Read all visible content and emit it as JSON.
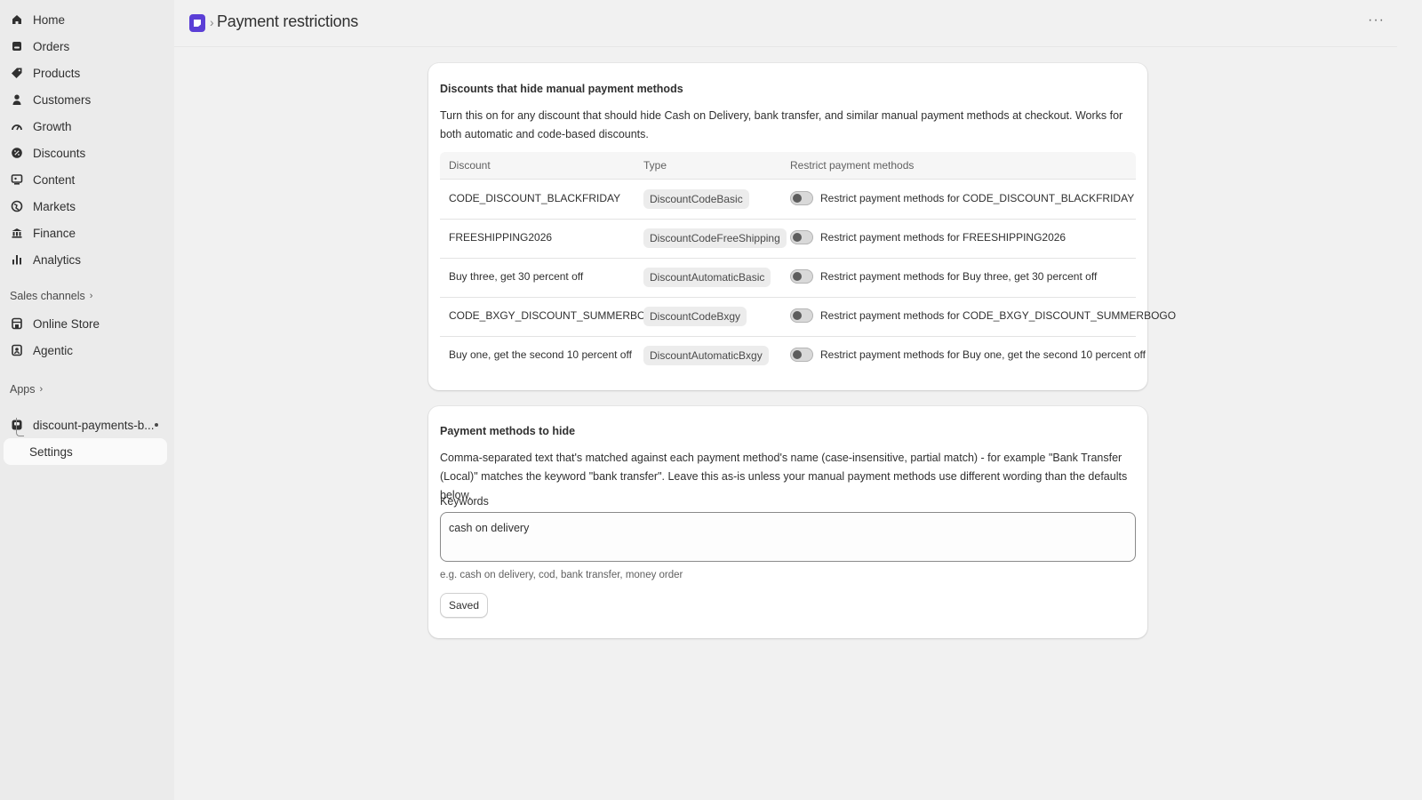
{
  "sidebar": {
    "items": [
      {
        "label": "Home",
        "icon": "home-icon"
      },
      {
        "label": "Orders",
        "icon": "orders-icon"
      },
      {
        "label": "Products",
        "icon": "tag-icon"
      },
      {
        "label": "Customers",
        "icon": "person-icon"
      },
      {
        "label": "Growth",
        "icon": "growth-icon"
      },
      {
        "label": "Discounts",
        "icon": "discount-icon"
      },
      {
        "label": "Content",
        "icon": "content-icon"
      },
      {
        "label": "Markets",
        "icon": "globe-icon"
      },
      {
        "label": "Finance",
        "icon": "bank-icon"
      },
      {
        "label": "Analytics",
        "icon": "bar-chart-icon"
      }
    ],
    "sales_channels_label": "Sales channels",
    "channels": [
      {
        "label": "Online Store",
        "icon": "store-icon"
      },
      {
        "label": "Agentic",
        "icon": "agentic-icon"
      }
    ],
    "apps_label": "Apps",
    "app_name": "discount-payments-b...",
    "app_sub_item": "Settings"
  },
  "header": {
    "title": "Payment restrictions",
    "separator": "›",
    "more": "···"
  },
  "discounts_card": {
    "title": "Discounts that hide manual payment methods",
    "description": "Turn this on for any discount that should hide Cash on Delivery, bank transfer, and similar manual payment methods at checkout. Works for both automatic and code-based discounts.",
    "columns": [
      "Discount",
      "Type",
      "Restrict payment methods"
    ],
    "rows": [
      {
        "discount": "CODE_DISCOUNT_BLACKFRIDAY",
        "type": "DiscountCodeBasic",
        "toggle_label": "Restrict payment methods for CODE_DISCOUNT_BLACKFRIDAY",
        "enabled": false
      },
      {
        "discount": "FREESHIPPING2026",
        "type": "DiscountCodeFreeShipping",
        "toggle_label": "Restrict payment methods for FREESHIPPING2026",
        "enabled": false
      },
      {
        "discount": "Buy three, get 30 percent off",
        "type": "DiscountAutomaticBasic",
        "toggle_label": "Restrict payment methods for Buy three, get 30 percent off",
        "enabled": false
      },
      {
        "discount": "CODE_BXGY_DISCOUNT_SUMMERBOGO",
        "type": "DiscountCodeBxgy",
        "toggle_label": "Restrict payment methods for CODE_BXGY_DISCOUNT_SUMMERBOGO",
        "enabled": false
      },
      {
        "discount": "Buy one, get the second 10 percent off",
        "type": "DiscountAutomaticBxgy",
        "toggle_label": "Restrict payment methods for Buy one, get the second 10 percent off",
        "enabled": false
      }
    ]
  },
  "payment_card": {
    "title": "Payment methods to hide",
    "description": "Comma-separated text that's matched against each payment method's name (case-insensitive, partial match) - for example \"Bank Transfer (Local)\" matches the keyword \"bank transfer\". Leave this as-is unless your manual payment methods use different wording than the defaults below.",
    "keywords_label": "Keywords",
    "keywords_value": "cash on delivery",
    "help_text": "e.g. cash on delivery, cod, bank transfer, money order",
    "save_label": "Saved"
  },
  "colors": {
    "app_logo": "#5b3fd6",
    "background": "#f1f1f1",
    "sidebar": "#ebebeb"
  }
}
